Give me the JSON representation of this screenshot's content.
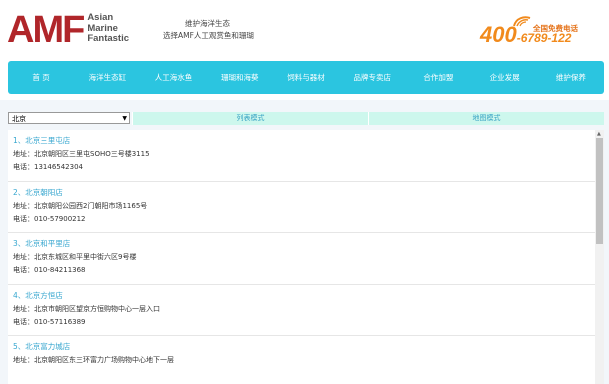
{
  "header": {
    "logo_text": "AMF",
    "logo_sub": [
      "Asian",
      "Marine",
      "Fantastic"
    ],
    "slogan_line1": "维护海洋生态",
    "slogan_line2": "选择AMF人工观赏鱼和珊瑚",
    "hotline_number_big": "400",
    "hotline_number_small": "-6789-122",
    "hotline_label": "全国免费电话"
  },
  "nav": {
    "items": [
      "首 页",
      "海洋生态缸",
      "人工海水鱼",
      "珊瑚和海葵",
      "饲料与器材",
      "品牌专卖店",
      "合作加盟",
      "企业发展",
      "维护保养"
    ]
  },
  "filter": {
    "city_selected": "北京",
    "tab_list": "列表模式",
    "tab_map": "地图模式"
  },
  "stores": [
    {
      "name": "1、北京三里屯店",
      "address": "地址：北京朝阳区三里屯SOHO三号楼3115",
      "phone": "电话：13146542304"
    },
    {
      "name": "2、北京朝阳店",
      "address": "地址：北京朝阳公园西2门朝阳市场1165号",
      "phone": "电话：010-57900212"
    },
    {
      "name": "3、北京和平里店",
      "address": "地址：北京东城区和平里中街六区9号楼",
      "phone": "电话：010-84211368"
    },
    {
      "name": "4、北京方恒店",
      "address": "地址：北京市朝阳区望京方恒购物中心一层入口",
      "phone": "电话：010-57116389"
    },
    {
      "name": "5、北京富力城店",
      "address": "地址：北京朝阳区东三环富力广场购物中心地下一层",
      "phone": ""
    }
  ],
  "colors": {
    "brand_red": "#b0262a",
    "nav_bg": "#2bc5e0",
    "tab_bg": "#cdf7ed",
    "link_blue": "#36a6cf",
    "hotline_orange": "#f18a1c"
  }
}
